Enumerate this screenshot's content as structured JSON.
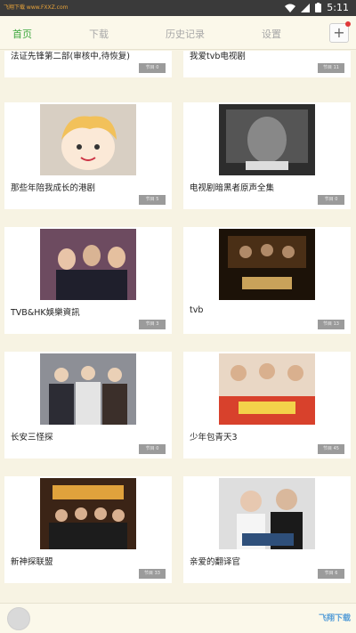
{
  "status_bar": {
    "watermark": "飞翔下载 www.FXXZ.com",
    "time": "5:11"
  },
  "tabs": [
    {
      "label": "首页"
    },
    {
      "label": "下载"
    },
    {
      "label": "历史记录"
    },
    {
      "label": "设置"
    }
  ],
  "add_button": {
    "label": "+"
  },
  "cards": [
    {
      "title": "法证先锋第二部(审核中,待恢复)",
      "badge": "节目 0"
    },
    {
      "title": "我爱tvb电视剧",
      "badge": "节目 11"
    },
    {
      "title": "那些年陪我成长的港剧",
      "badge": "节目 5"
    },
    {
      "title": "电视剧暗黑者原声全集",
      "badge": "节目 0"
    },
    {
      "title": "TVB&HK娛樂資訊",
      "badge": "节目 3"
    },
    {
      "title": "tvb",
      "badge": "节目 13"
    },
    {
      "title": "长安三怪探",
      "badge": "节目 0"
    },
    {
      "title": "少年包青天3",
      "badge": "节目 45"
    },
    {
      "title": "新神探联盟",
      "badge": "节目 33"
    },
    {
      "title": "亲爱的翻译官",
      "badge": "节目 6"
    }
  ],
  "bottom_bar": {
    "logo_text": "飞翔下载"
  },
  "colors": {
    "active_tab": "#3fa83f",
    "inactive_tab": "#a8a8a8",
    "background": "#f7f3e3",
    "badge": "#9b9b9b",
    "notification_dot": "#e0393a"
  }
}
